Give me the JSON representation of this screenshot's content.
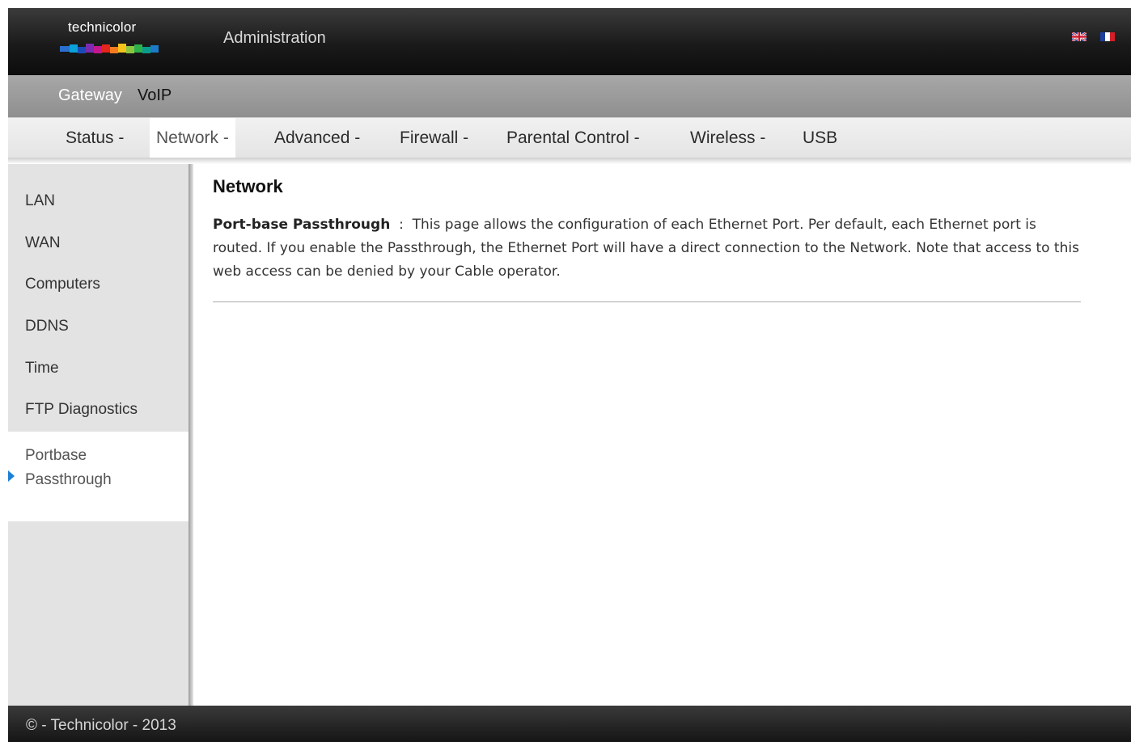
{
  "header": {
    "logo_text": "technicolor",
    "title": "Administration",
    "languages": [
      {
        "name": "english-flag-icon"
      },
      {
        "name": "french-flag-icon"
      }
    ]
  },
  "nav_primary": {
    "items": [
      {
        "label": "Gateway"
      },
      {
        "label": "VoIP"
      }
    ]
  },
  "nav_secondary": {
    "items": [
      {
        "label": "Status -"
      },
      {
        "label": "Network -"
      },
      {
        "label": "Advanced -"
      },
      {
        "label": "Firewall -"
      },
      {
        "label": "Parental Control -"
      },
      {
        "label": "Wireless -"
      },
      {
        "label": "USB"
      }
    ],
    "active_index": 1
  },
  "sidebar": {
    "items": [
      {
        "label": "LAN"
      },
      {
        "label": "WAN"
      },
      {
        "label": "Computers"
      },
      {
        "label": "DDNS"
      },
      {
        "label": "Time"
      },
      {
        "label": "FTP Diagnostics"
      }
    ],
    "active_label": "Portbase Passthrough"
  },
  "main": {
    "title": "Network",
    "desc_label": "Port-base Passthrough",
    "desc_sep": "  :  ",
    "desc_text": "This page allows the configuration of each Ethernet Port. Per default, each Ethernet port is routed. If you enable the Passthrough, the Ethernet Port will have a direct connection to the Network. Note that access to this web access can be denied by your Cable operator."
  },
  "footer": {
    "text": "© - Technicolor - 2013"
  },
  "colors": {
    "accent_arrow": "#1e7fd6",
    "header_bg": "#1a1a1a",
    "nav_primary_bg": "#999999",
    "sidebar_bg": "#e3e3e3"
  }
}
